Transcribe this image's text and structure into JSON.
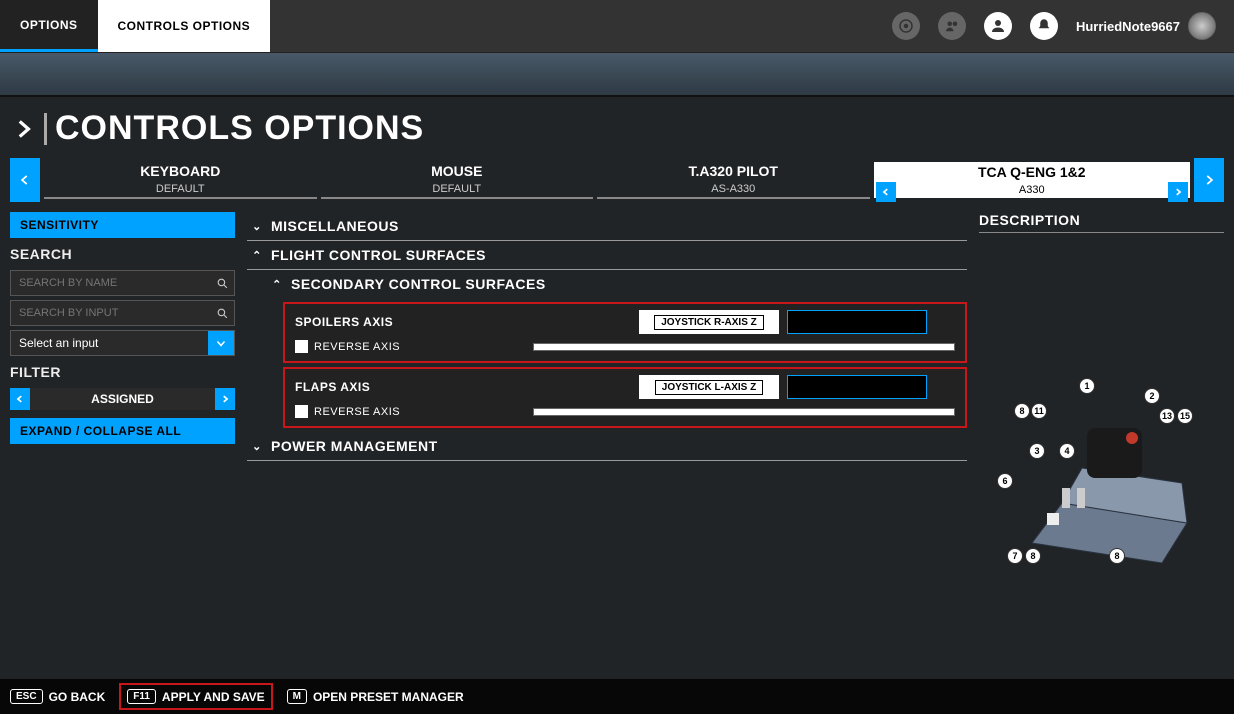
{
  "tabs": {
    "options": "OPTIONS",
    "controls": "CONTROLS OPTIONS"
  },
  "user": {
    "name": "HurriedNote9667"
  },
  "page_title": "CONTROLS OPTIONS",
  "devices": [
    {
      "name": "KEYBOARD",
      "preset": "DEFAULT"
    },
    {
      "name": "MOUSE",
      "preset": "DEFAULT"
    },
    {
      "name": "T.A320 PILOT",
      "preset": "AS-A330"
    },
    {
      "name": "TCA Q-ENG 1&2",
      "preset": "A330"
    }
  ],
  "sidebar": {
    "sensitivity": "SENSITIVITY",
    "search_label": "SEARCH",
    "search_name_ph": "SEARCH BY NAME",
    "search_input_ph": "SEARCH BY INPUT",
    "select_input": "Select an input",
    "filter_label": "FILTER",
    "filter_value": "ASSIGNED",
    "expand": "EXPAND / COLLAPSE ALL"
  },
  "categories": {
    "misc": "MISCELLANEOUS",
    "fcs": "FLIGHT CONTROL SURFACES",
    "scs": "SECONDARY CONTROL SURFACES",
    "power": "POWER MANAGEMENT"
  },
  "bindings": {
    "spoilers": {
      "name": "SPOILERS AXIS",
      "assigned": "JOYSTICK R-AXIS Z",
      "reverse": "REVERSE AXIS"
    },
    "flaps": {
      "name": "FLAPS AXIS",
      "assigned": "JOYSTICK L-AXIS Z",
      "reverse": "REVERSE AXIS"
    }
  },
  "description": {
    "title": "DESCRIPTION"
  },
  "footer": {
    "back_key": "ESC",
    "back": "GO BACK",
    "apply_key": "F11",
    "apply": "APPLY AND SAVE",
    "preset_key": "M",
    "preset": "OPEN PRESET MANAGER"
  }
}
